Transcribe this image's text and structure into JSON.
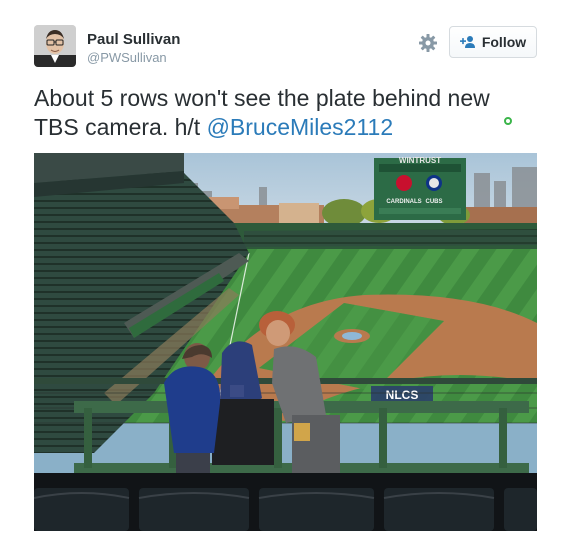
{
  "author": {
    "name": "Paul Sullivan",
    "handle": "@PWSullivan"
  },
  "actions": {
    "settings_icon": "gear-icon",
    "follow_label": "Follow",
    "follow_icon": "add-user-icon"
  },
  "tweet": {
    "text_before": "About 5 rows won't see the plate behind new TBS camera. h/t ",
    "mention": "@BruceMiles2112"
  },
  "photo": {
    "scoreboard": {
      "sponsor": "WINTRUST",
      "team_left": "CARDINALS",
      "team_right": "CUBS"
    },
    "field_logo": "NLCS"
  },
  "colors": {
    "link": "#2b7bb9",
    "geo_indicator": "#3bb54a",
    "text": "#292f33",
    "muted": "#8899a6"
  }
}
